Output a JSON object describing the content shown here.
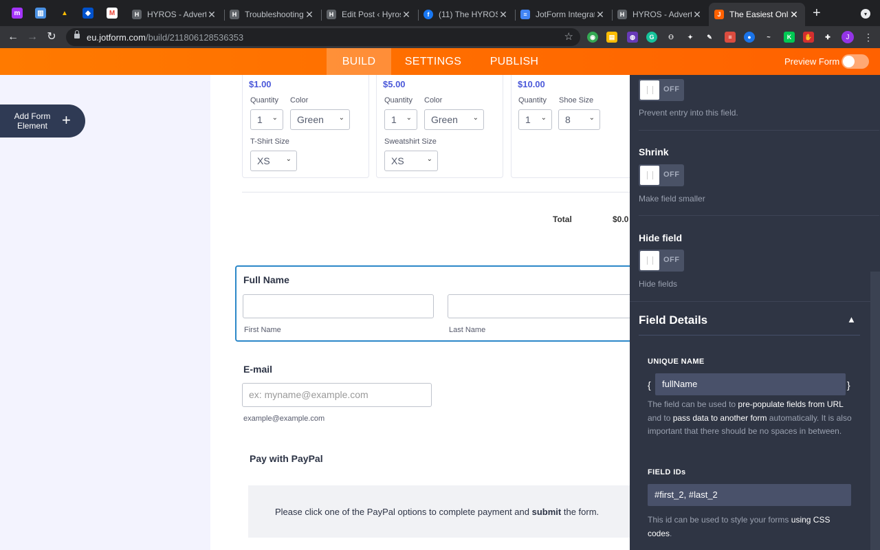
{
  "browser": {
    "tabs": [
      {
        "title": "HYROS - Advertis",
        "color": "#5f6368",
        "icon": "hyros-icon"
      },
      {
        "title": "Troubleshooting",
        "color": "#5f6368",
        "icon": "hyros-icon"
      },
      {
        "title": "Edit Post ‹ Hyros",
        "color": "#5f6368",
        "icon": "hyros-icon"
      },
      {
        "title": "(11) The HYROS",
        "color": "#1877f2",
        "icon": "facebook-icon"
      },
      {
        "title": "JotForm Integrat",
        "color": "#4285f4",
        "icon": "docs-icon"
      },
      {
        "title": "HYROS - Advertis",
        "color": "#5f6368",
        "icon": "hyros-icon"
      },
      {
        "title": "The Easiest Onlin",
        "color": "#ff6100",
        "icon": "jotform-icon"
      }
    ],
    "url_host": "eu.jotform.com",
    "url_path": "/build/211806128536353"
  },
  "header": {
    "nav": [
      "BUILD",
      "SETTINGS",
      "PUBLISH"
    ],
    "preview_label": "Preview Form",
    "accent": "#ff6100"
  },
  "sidebar_left": {
    "add_element_label": "Add Form Element",
    "plus": "+"
  },
  "form": {
    "products": [
      {
        "price": "$1.00",
        "opts": [
          {
            "label": "Quantity",
            "value": "1"
          },
          {
            "label": "Color",
            "value": "Green"
          }
        ],
        "extra_label": "T-Shirt Size",
        "extra_value": "XS"
      },
      {
        "price": "$5.00",
        "opts": [
          {
            "label": "Quantity",
            "value": "1"
          },
          {
            "label": "Color",
            "value": "Green"
          }
        ],
        "extra_label": "Sweatshirt Size",
        "extra_value": "XS"
      },
      {
        "price": "$10.00",
        "opts": [
          {
            "label": "Quantity",
            "value": "1"
          },
          {
            "label": "Shoe Size",
            "value": "8"
          }
        ]
      }
    ],
    "total_label": "Total",
    "total_value": "$0.0",
    "full_name": {
      "title": "Full Name",
      "first_label": "First Name",
      "last_label": "Last Name"
    },
    "email": {
      "title": "E-mail",
      "placeholder": "ex: myname@example.com",
      "sublabel": "example@example.com"
    },
    "paypal": {
      "title": "Pay with PayPal",
      "text_before": "Please click one of the PayPal options to complete payment and ",
      "text_bold": "submit",
      "text_after": " the form."
    }
  },
  "panel": {
    "off_label": "OFF",
    "readonly_desc": "Prevent entry into this field.",
    "shrink_title": "Shrink",
    "shrink_desc": "Make field smaller",
    "hide_title": "Hide field",
    "hide_desc": "Hide fields",
    "details_title": "Field Details",
    "unique_name_label": "UNIQUE NAME",
    "unique_name_value": "fullName",
    "brace_open": "{",
    "brace_close": "}",
    "unique_help_1": "The field can be used to ",
    "unique_help_b1": "pre-populate fields from URL",
    "unique_help_2": " and to ",
    "unique_help_b2": "pass data to another form",
    "unique_help_3": " automatically. It is also important that there should be no spaces in between.",
    "field_ids_label": "FIELD IDs",
    "field_ids_value": "#first_2, #last_2",
    "ids_help_1": "This id can be used to style your forms ",
    "ids_help_b": "using CSS codes",
    "ids_help_2": "."
  }
}
